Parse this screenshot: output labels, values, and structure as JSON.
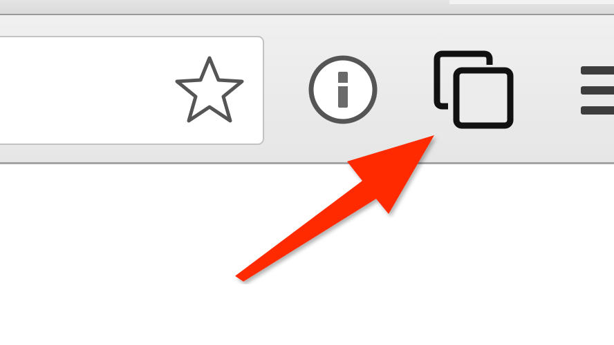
{
  "toolbar": {
    "url_bar": {
      "value": "",
      "placeholder": ""
    },
    "icons": {
      "bookmark": "star-outline-icon",
      "password_manager": "onepassword-icon",
      "tab_overview": "stacked-squares-icon",
      "menu": "hamburger-menu-icon"
    }
  },
  "annotation": {
    "arrow_color": "#ff2a00"
  },
  "colors": {
    "icon_stroke": "#555555",
    "tabs_icon_stroke": "#111111",
    "toolbar_bg": "#ececec"
  }
}
